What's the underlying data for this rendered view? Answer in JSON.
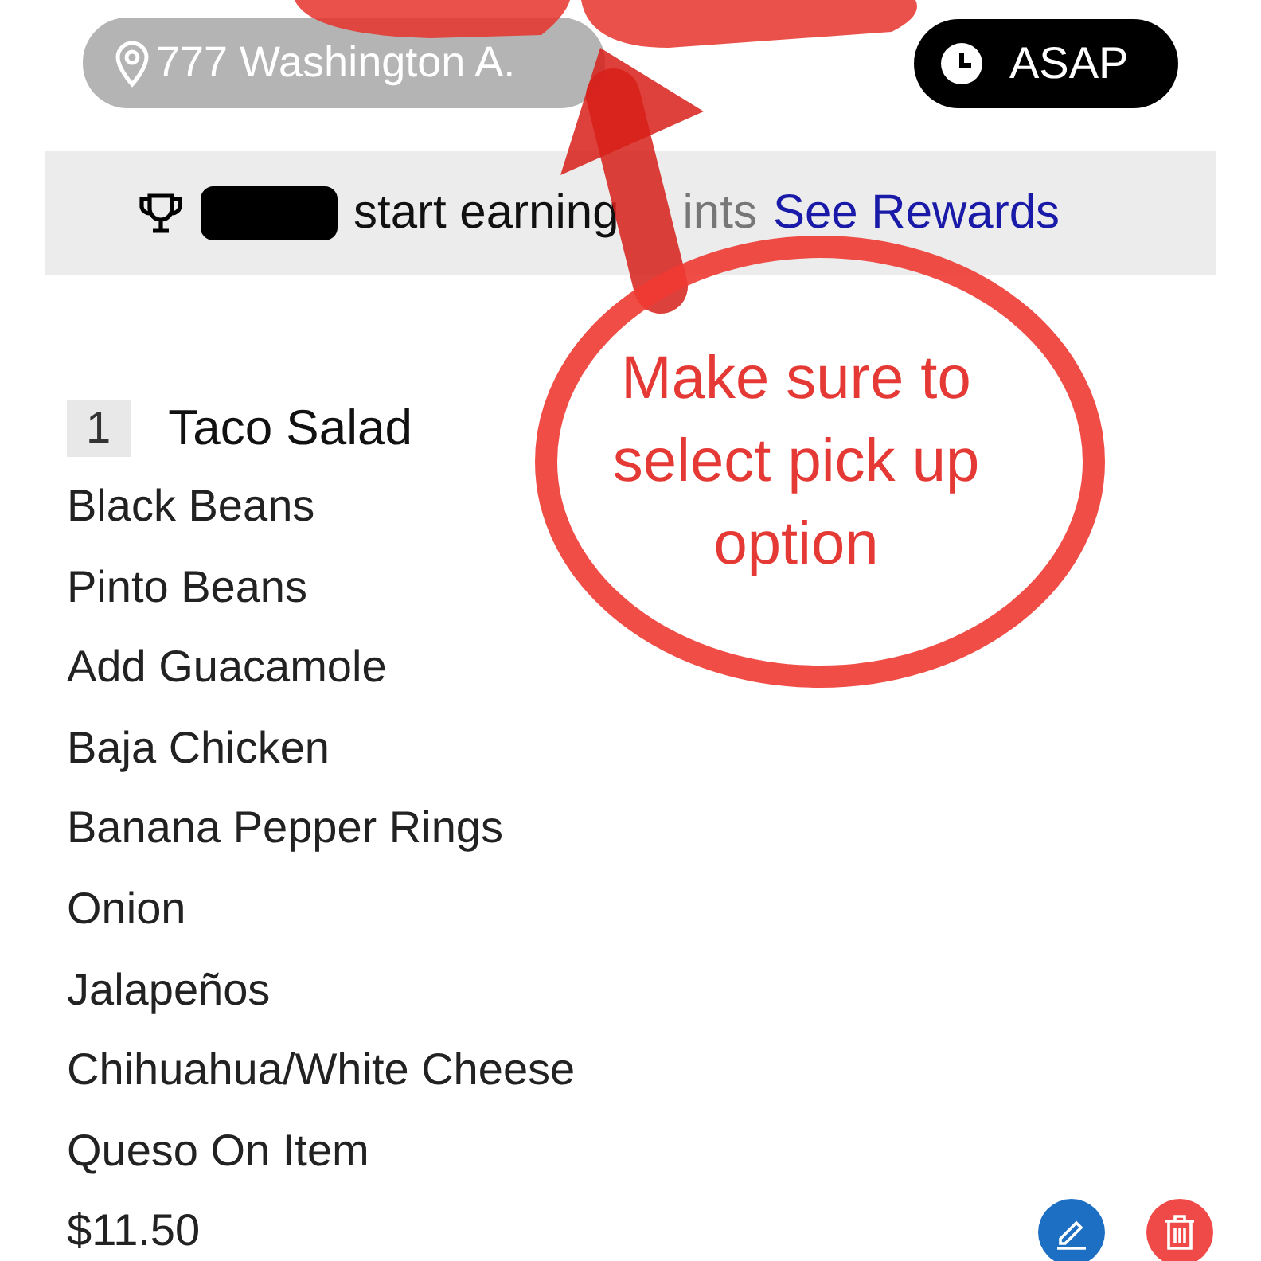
{
  "location": {
    "text": "777 Washington A."
  },
  "time": {
    "label": "ASAP"
  },
  "rewards": {
    "before": "start earning",
    "after": "ints",
    "link": "See Rewards"
  },
  "order": {
    "quantity": "1",
    "name": "Taco Salad",
    "options": [
      "Black Beans",
      "Pinto Beans",
      "Add Guacamole",
      "Baja Chicken",
      "Banana Pepper Rings",
      "Onion",
      "Jalapeños",
      "Chihuahua/White Cheese",
      "Queso On Item"
    ],
    "price": "$11.50"
  },
  "annotation": {
    "lines": [
      "Make sure to",
      "select pick up",
      "option"
    ]
  }
}
